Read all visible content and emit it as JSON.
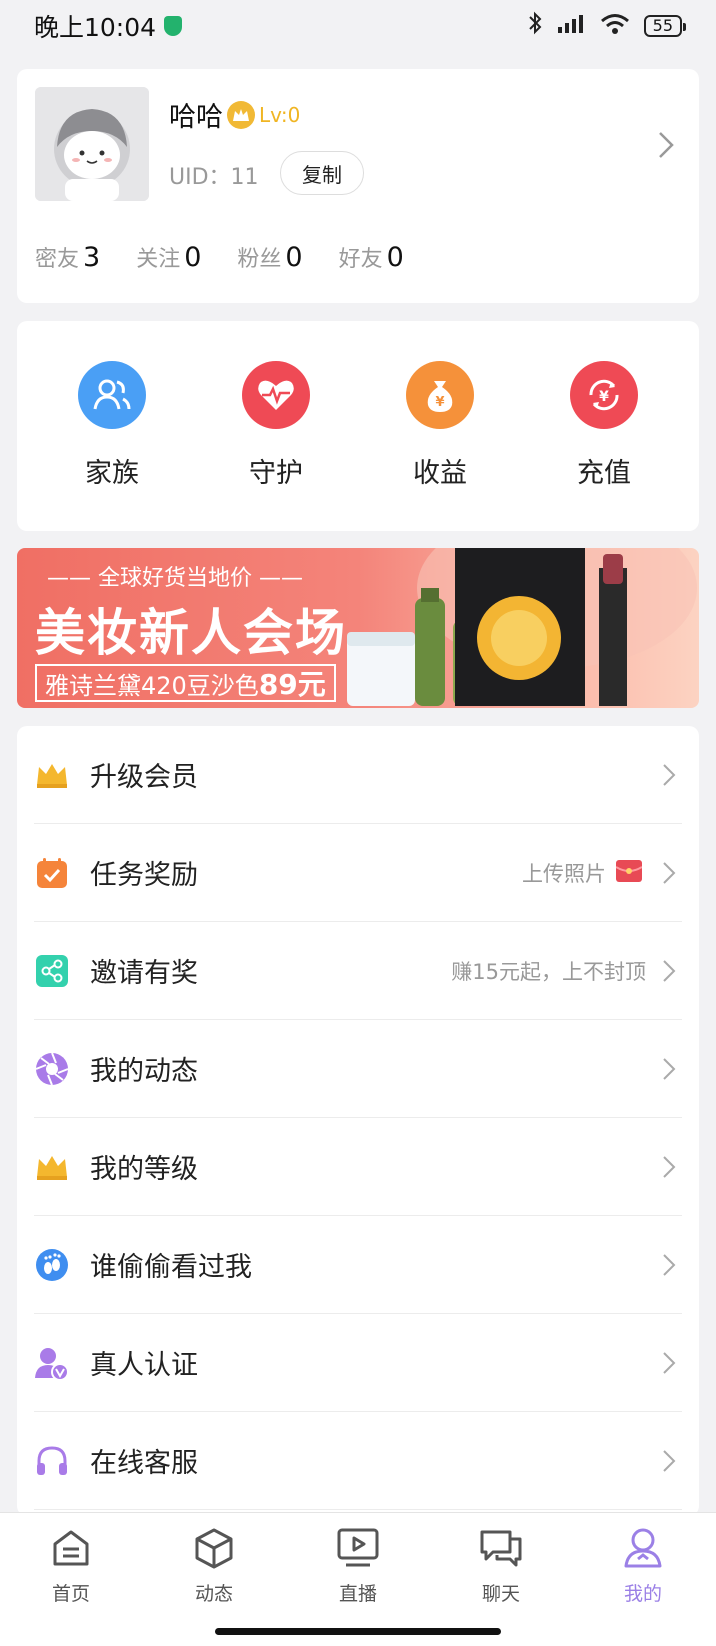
{
  "status_bar": {
    "time": "晚上10:04",
    "battery": "55"
  },
  "profile": {
    "name": "哈哈",
    "level": "Lv:0",
    "uid": "UID：11",
    "copy_label": "复制",
    "stats": [
      {
        "label": "密友",
        "value": "3"
      },
      {
        "label": "关注",
        "value": "0"
      },
      {
        "label": "粉丝",
        "value": "0"
      },
      {
        "label": "好友",
        "value": "0"
      }
    ]
  },
  "quick_actions": [
    {
      "label": "家族",
      "icon": "family-icon",
      "color": "#4a9ff5"
    },
    {
      "label": "守护",
      "icon": "heartbeat-icon",
      "color": "#ef4a55"
    },
    {
      "label": "收益",
      "icon": "money-bag-icon",
      "color": "#f5913a"
    },
    {
      "label": "充值",
      "icon": "recharge-icon",
      "color": "#ef4a55"
    }
  ],
  "banner": {
    "tag": "—— 全球好货当地价 ——",
    "title": "美妆新人会场",
    "offer_prefix": "雅诗兰黛420豆沙色",
    "offer_price": "89元"
  },
  "menu": [
    {
      "label": "升级会员",
      "note": "",
      "icon": "crown-icon"
    },
    {
      "label": "任务奖励",
      "note": "上传照片",
      "icon": "calendar-check-icon"
    },
    {
      "label": "邀请有奖",
      "note": "赚15元起，上不封顶",
      "icon": "share-icon"
    },
    {
      "label": "我的动态",
      "note": "",
      "icon": "aperture-icon"
    },
    {
      "label": "我的等级",
      "note": "",
      "icon": "crown-icon"
    },
    {
      "label": "谁偷偷看过我",
      "note": "",
      "icon": "footprint-icon"
    },
    {
      "label": "真人认证",
      "note": "",
      "icon": "verified-user-icon"
    },
    {
      "label": "在线客服",
      "note": "",
      "icon": "headset-icon"
    }
  ],
  "tabs": [
    {
      "label": "首页",
      "icon": "home-icon"
    },
    {
      "label": "动态",
      "icon": "cube-icon"
    },
    {
      "label": "直播",
      "icon": "live-tv-icon"
    },
    {
      "label": "聊天",
      "icon": "chat-icon"
    },
    {
      "label": "我的",
      "icon": "profile-icon",
      "active": true
    }
  ]
}
